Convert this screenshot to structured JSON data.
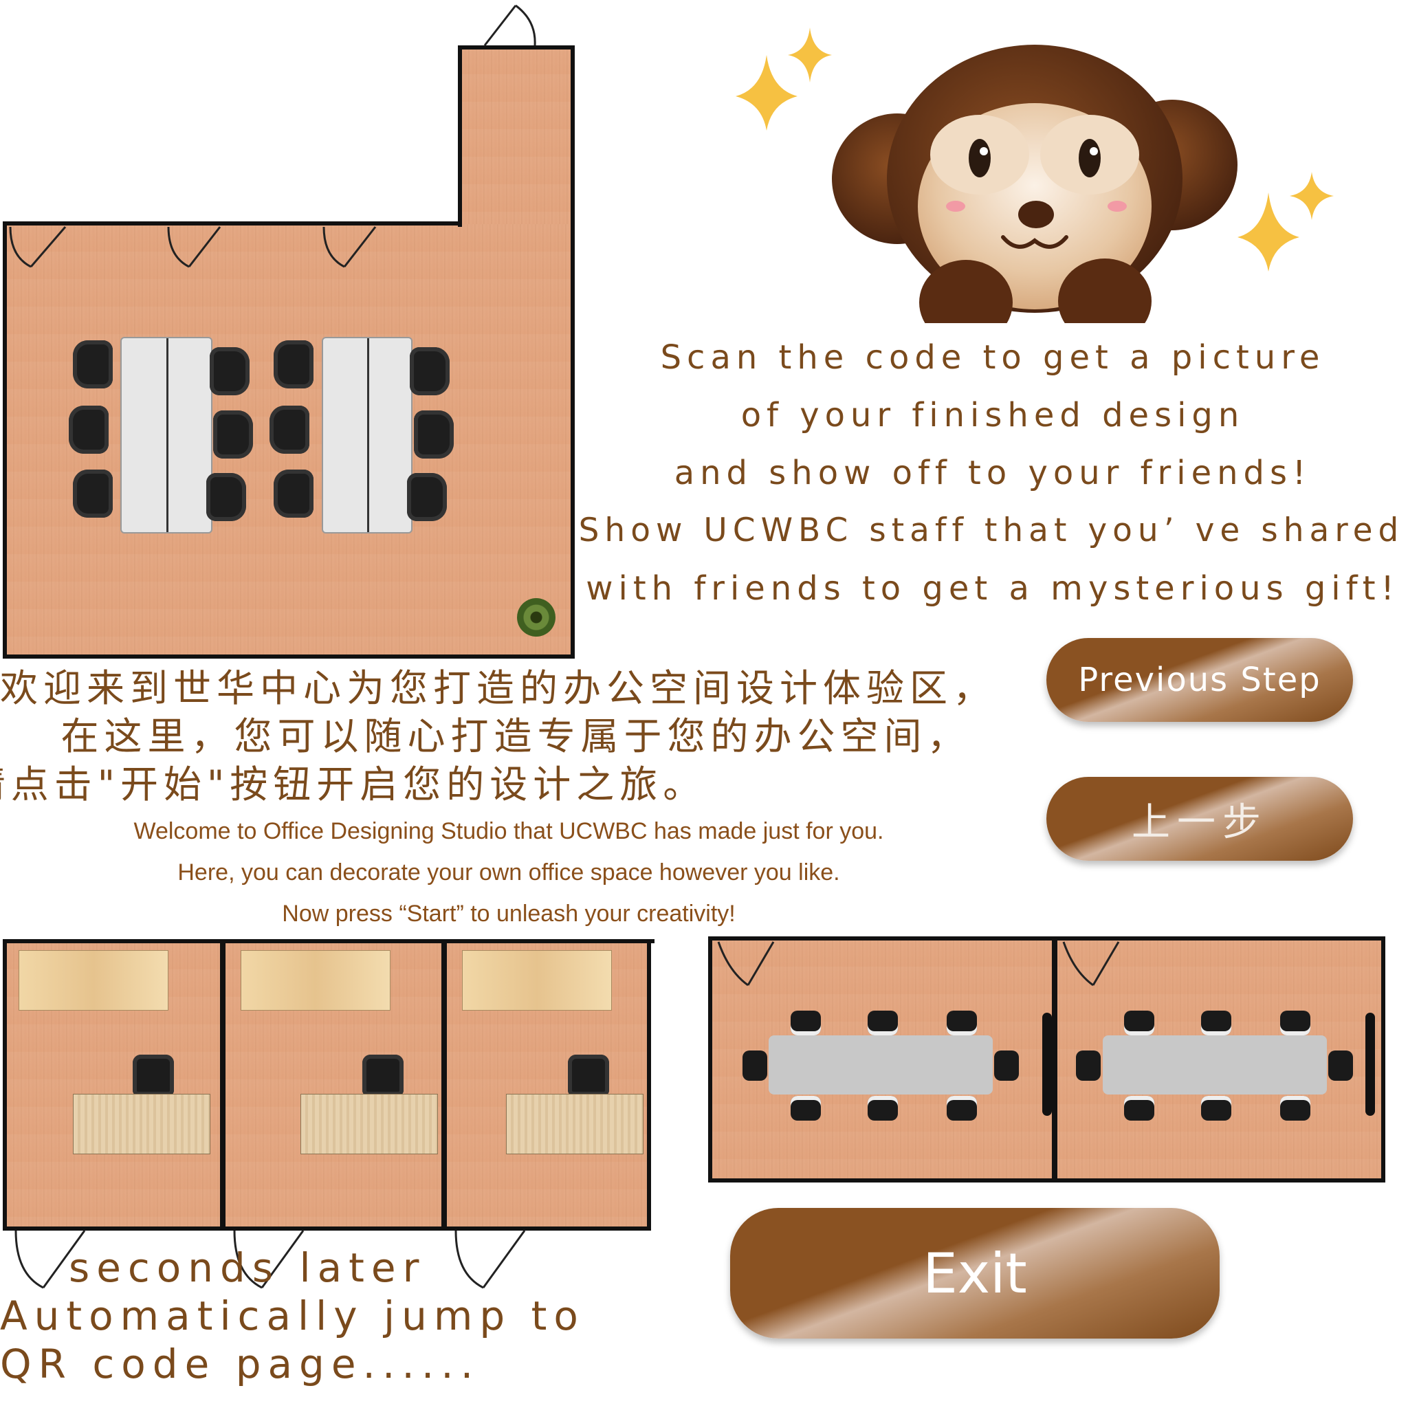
{
  "scan_message": {
    "lines": [
      "Scan the code to get a picture",
      "of your finished design",
      "and show off to your friends!",
      "Show UCWBC staff that you’ ve shared",
      "with friends to get a mysterious gift!"
    ]
  },
  "welcome_cn": {
    "lines": [
      "欢迎来到世华中心为您打造的办公空间设计体验区，",
      "在这里，您可以随心打造专属于您的办公空间，",
      "请点击\"开始\"按钮开启您的设计之旅。"
    ]
  },
  "welcome_en": {
    "lines": [
      "Welcome to Office Designing Studio that UCWBC has made just for you.",
      "Here, you can decorate your own office space however you like.",
      "Now press  “Start”  to unleash your creativity!"
    ]
  },
  "countdown": {
    "lines": [
      "seconds later",
      "Automatically jump to",
      "QR code page......"
    ]
  },
  "buttons": {
    "previous_step": "Previous Step",
    "previous_step_cn": "上一步",
    "exit": "Exit"
  },
  "icons": {
    "mascot": "monkey-mascot-icon",
    "sparkle": "sparkle-icon"
  },
  "colors": {
    "text_brown": "#7a4a1c",
    "button_brown": "#8a5222",
    "wood_floor": "#e3a57f"
  }
}
